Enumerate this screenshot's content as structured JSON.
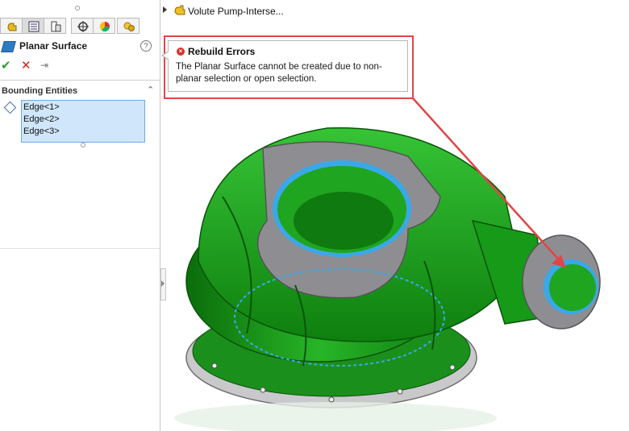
{
  "property_manager": {
    "tabs": [
      {
        "name": "feature-manager",
        "icon": "feature-manager-icon"
      },
      {
        "name": "property-manager",
        "icon": "property-manager-icon",
        "active": true
      },
      {
        "name": "configuration-manager",
        "icon": "configuration-manager-icon"
      },
      {
        "name": "dimxpert-manager",
        "icon": "dimxpert-icon"
      },
      {
        "name": "display-manager",
        "icon": "display-manager-icon"
      },
      {
        "name": "appearances",
        "icon": "appearance-icon"
      }
    ],
    "title": "Planar Surface",
    "help_icon": "help-icon",
    "actions": {
      "ok": "✔",
      "cancel": "✕",
      "pin": "⇥"
    },
    "group": {
      "title": "Bounding Entities",
      "items": [
        "Edge<1>",
        "Edge<2>",
        "Edge<3>"
      ]
    }
  },
  "feature_tree": {
    "root_label": "Volute Pump-Interse..."
  },
  "error_tooltip": {
    "title": "Rebuild Errors",
    "icon": "error-icon",
    "message": "The Planar Surface cannot be created due to non-planar selection or open selection."
  },
  "colors": {
    "model_green": "#1fa51f",
    "flange_gray": "#8e8e92",
    "selection_blue": "#3aa8e8",
    "callout_red": "#e04646"
  }
}
